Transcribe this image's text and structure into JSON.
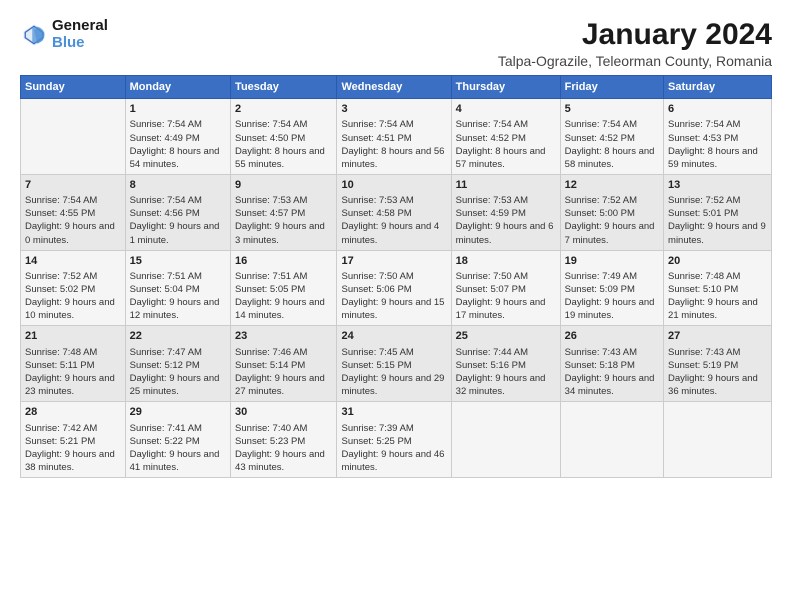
{
  "logo": {
    "line1": "General",
    "line2": "Blue"
  },
  "title": "January 2024",
  "subtitle": "Talpa-Ograzile, Teleorman County, Romania",
  "days_header": [
    "Sunday",
    "Monday",
    "Tuesday",
    "Wednesday",
    "Thursday",
    "Friday",
    "Saturday"
  ],
  "weeks": [
    [
      {
        "day": "",
        "sunrise": "",
        "sunset": "",
        "daylight": ""
      },
      {
        "day": "1",
        "sunrise": "Sunrise: 7:54 AM",
        "sunset": "Sunset: 4:49 PM",
        "daylight": "Daylight: 8 hours and 54 minutes."
      },
      {
        "day": "2",
        "sunrise": "Sunrise: 7:54 AM",
        "sunset": "Sunset: 4:50 PM",
        "daylight": "Daylight: 8 hours and 55 minutes."
      },
      {
        "day": "3",
        "sunrise": "Sunrise: 7:54 AM",
        "sunset": "Sunset: 4:51 PM",
        "daylight": "Daylight: 8 hours and 56 minutes."
      },
      {
        "day": "4",
        "sunrise": "Sunrise: 7:54 AM",
        "sunset": "Sunset: 4:52 PM",
        "daylight": "Daylight: 8 hours and 57 minutes."
      },
      {
        "day": "5",
        "sunrise": "Sunrise: 7:54 AM",
        "sunset": "Sunset: 4:52 PM",
        "daylight": "Daylight: 8 hours and 58 minutes."
      },
      {
        "day": "6",
        "sunrise": "Sunrise: 7:54 AM",
        "sunset": "Sunset: 4:53 PM",
        "daylight": "Daylight: 8 hours and 59 minutes."
      }
    ],
    [
      {
        "day": "7",
        "sunrise": "Sunrise: 7:54 AM",
        "sunset": "Sunset: 4:55 PM",
        "daylight": "Daylight: 9 hours and 0 minutes."
      },
      {
        "day": "8",
        "sunrise": "Sunrise: 7:54 AM",
        "sunset": "Sunset: 4:56 PM",
        "daylight": "Daylight: 9 hours and 1 minute."
      },
      {
        "day": "9",
        "sunrise": "Sunrise: 7:53 AM",
        "sunset": "Sunset: 4:57 PM",
        "daylight": "Daylight: 9 hours and 3 minutes."
      },
      {
        "day": "10",
        "sunrise": "Sunrise: 7:53 AM",
        "sunset": "Sunset: 4:58 PM",
        "daylight": "Daylight: 9 hours and 4 minutes."
      },
      {
        "day": "11",
        "sunrise": "Sunrise: 7:53 AM",
        "sunset": "Sunset: 4:59 PM",
        "daylight": "Daylight: 9 hours and 6 minutes."
      },
      {
        "day": "12",
        "sunrise": "Sunrise: 7:52 AM",
        "sunset": "Sunset: 5:00 PM",
        "daylight": "Daylight: 9 hours and 7 minutes."
      },
      {
        "day": "13",
        "sunrise": "Sunrise: 7:52 AM",
        "sunset": "Sunset: 5:01 PM",
        "daylight": "Daylight: 9 hours and 9 minutes."
      }
    ],
    [
      {
        "day": "14",
        "sunrise": "Sunrise: 7:52 AM",
        "sunset": "Sunset: 5:02 PM",
        "daylight": "Daylight: 9 hours and 10 minutes."
      },
      {
        "day": "15",
        "sunrise": "Sunrise: 7:51 AM",
        "sunset": "Sunset: 5:04 PM",
        "daylight": "Daylight: 9 hours and 12 minutes."
      },
      {
        "day": "16",
        "sunrise": "Sunrise: 7:51 AM",
        "sunset": "Sunset: 5:05 PM",
        "daylight": "Daylight: 9 hours and 14 minutes."
      },
      {
        "day": "17",
        "sunrise": "Sunrise: 7:50 AM",
        "sunset": "Sunset: 5:06 PM",
        "daylight": "Daylight: 9 hours and 15 minutes."
      },
      {
        "day": "18",
        "sunrise": "Sunrise: 7:50 AM",
        "sunset": "Sunset: 5:07 PM",
        "daylight": "Daylight: 9 hours and 17 minutes."
      },
      {
        "day": "19",
        "sunrise": "Sunrise: 7:49 AM",
        "sunset": "Sunset: 5:09 PM",
        "daylight": "Daylight: 9 hours and 19 minutes."
      },
      {
        "day": "20",
        "sunrise": "Sunrise: 7:48 AM",
        "sunset": "Sunset: 5:10 PM",
        "daylight": "Daylight: 9 hours and 21 minutes."
      }
    ],
    [
      {
        "day": "21",
        "sunrise": "Sunrise: 7:48 AM",
        "sunset": "Sunset: 5:11 PM",
        "daylight": "Daylight: 9 hours and 23 minutes."
      },
      {
        "day": "22",
        "sunrise": "Sunrise: 7:47 AM",
        "sunset": "Sunset: 5:12 PM",
        "daylight": "Daylight: 9 hours and 25 minutes."
      },
      {
        "day": "23",
        "sunrise": "Sunrise: 7:46 AM",
        "sunset": "Sunset: 5:14 PM",
        "daylight": "Daylight: 9 hours and 27 minutes."
      },
      {
        "day": "24",
        "sunrise": "Sunrise: 7:45 AM",
        "sunset": "Sunset: 5:15 PM",
        "daylight": "Daylight: 9 hours and 29 minutes."
      },
      {
        "day": "25",
        "sunrise": "Sunrise: 7:44 AM",
        "sunset": "Sunset: 5:16 PM",
        "daylight": "Daylight: 9 hours and 32 minutes."
      },
      {
        "day": "26",
        "sunrise": "Sunrise: 7:43 AM",
        "sunset": "Sunset: 5:18 PM",
        "daylight": "Daylight: 9 hours and 34 minutes."
      },
      {
        "day": "27",
        "sunrise": "Sunrise: 7:43 AM",
        "sunset": "Sunset: 5:19 PM",
        "daylight": "Daylight: 9 hours and 36 minutes."
      }
    ],
    [
      {
        "day": "28",
        "sunrise": "Sunrise: 7:42 AM",
        "sunset": "Sunset: 5:21 PM",
        "daylight": "Daylight: 9 hours and 38 minutes."
      },
      {
        "day": "29",
        "sunrise": "Sunrise: 7:41 AM",
        "sunset": "Sunset: 5:22 PM",
        "daylight": "Daylight: 9 hours and 41 minutes."
      },
      {
        "day": "30",
        "sunrise": "Sunrise: 7:40 AM",
        "sunset": "Sunset: 5:23 PM",
        "daylight": "Daylight: 9 hours and 43 minutes."
      },
      {
        "day": "31",
        "sunrise": "Sunrise: 7:39 AM",
        "sunset": "Sunset: 5:25 PM",
        "daylight": "Daylight: 9 hours and 46 minutes."
      },
      {
        "day": "",
        "sunrise": "",
        "sunset": "",
        "daylight": ""
      },
      {
        "day": "",
        "sunrise": "",
        "sunset": "",
        "daylight": ""
      },
      {
        "day": "",
        "sunrise": "",
        "sunset": "",
        "daylight": ""
      }
    ]
  ]
}
